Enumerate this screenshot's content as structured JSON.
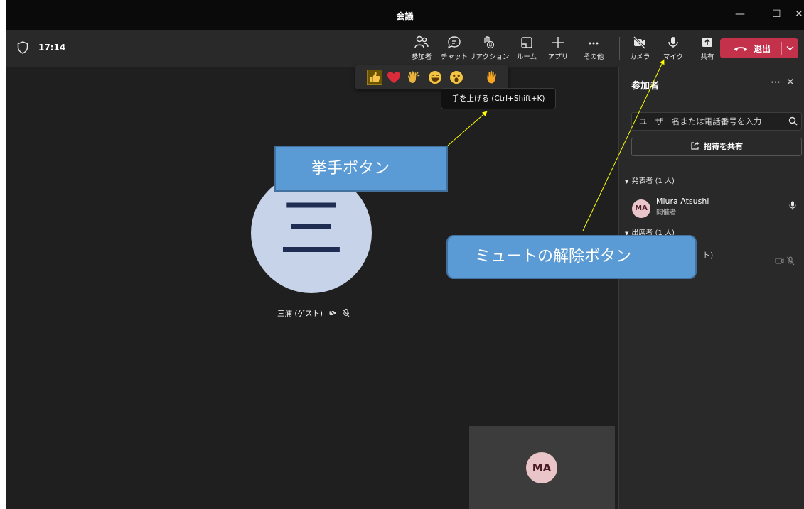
{
  "window": {
    "title": "会議"
  },
  "toolbar": {
    "clock": "17:14",
    "buttons": [
      {
        "label": "参加者",
        "icon": "people-icon"
      },
      {
        "label": "チャット",
        "icon": "chat-icon"
      },
      {
        "label": "リアクション",
        "icon": "reaction-icon"
      },
      {
        "label": "ルーム",
        "icon": "rooms-icon"
      },
      {
        "label": "アプリ",
        "icon": "plus-icon"
      },
      {
        "label": "その他",
        "icon": "more-icon"
      },
      {
        "label": "カメラ",
        "icon": "camera-off-icon"
      },
      {
        "label": "マイク",
        "icon": "mic-icon"
      },
      {
        "label": "共有",
        "icon": "share-screen-icon"
      }
    ],
    "leave_label": "退出",
    "leave_color": "#c4314b"
  },
  "reactions": {
    "items": [
      "like-icon",
      "heart-icon",
      "applause-icon",
      "laugh-icon",
      "surprised-icon"
    ],
    "raise_hand_icon": "raise-hand-icon",
    "tooltip": "手を上げる (Ctrl+Shift+K)"
  },
  "stage": {
    "participant_avatar_text": "三",
    "participant_name": "三浦 (ゲスト)",
    "self_avatar": "MA"
  },
  "panel": {
    "title": "参加者",
    "search_placeholder": "ユーザー名または電話番号を入力",
    "share_invite_label": "招待を共有",
    "presenters_header": "発表者 (1 人)",
    "presenter": {
      "initials": "MA",
      "name": "Miura Atsushi",
      "role": "開催者"
    },
    "attendees_header": "出席者 (1 人)",
    "attendee_partial": "ト)"
  },
  "annotations": {
    "raise_hand_callout": "挙手ボタン",
    "unmute_callout": "ミュートの解除ボタン",
    "arrow_color": "#ffff00",
    "callout_color": "#5b9bd5"
  }
}
